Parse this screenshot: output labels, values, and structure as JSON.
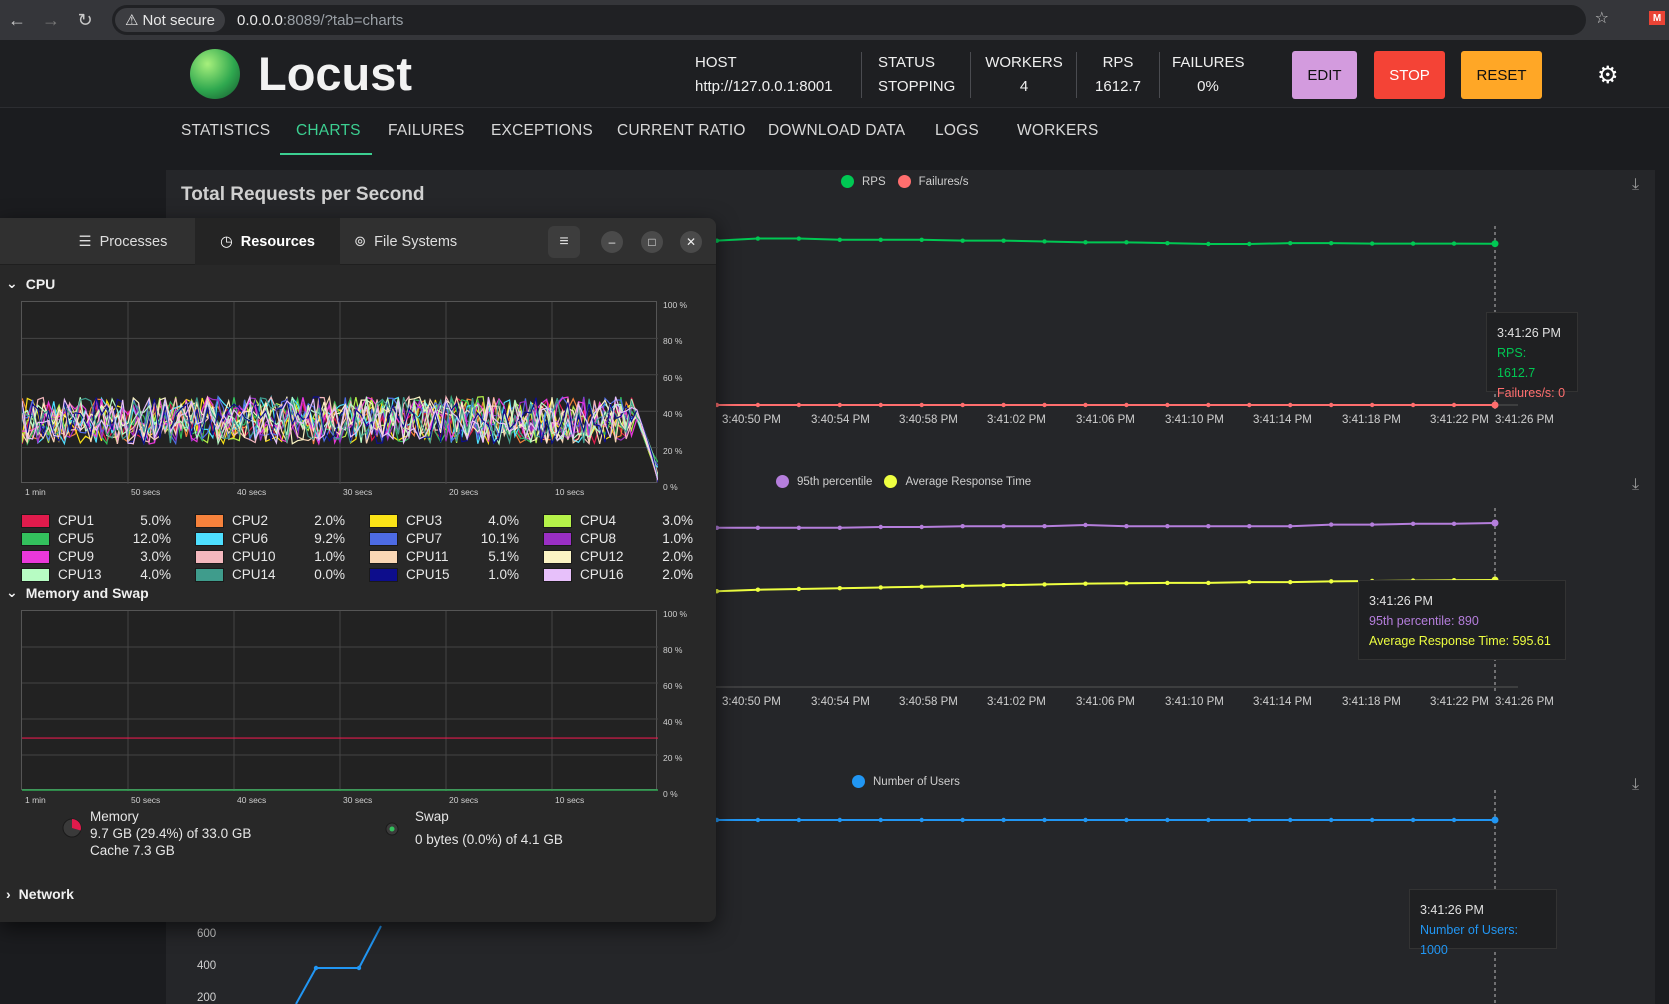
{
  "browser": {
    "not_secure": "Not secure",
    "url_host": "0.0.0.0",
    "url_rest": ":8089/?tab=charts"
  },
  "header": {
    "app_name": "Locust",
    "host_label": "HOST",
    "host_value": "http://127.0.0.1:8001",
    "status_label": "STATUS",
    "status_value": "STOPPING",
    "workers_label": "WORKERS",
    "workers_value": "4",
    "rps_label": "RPS",
    "rps_value": "1612.7",
    "failures_label": "FAILURES",
    "failures_value": "0%",
    "edit": "EDIT",
    "stop": "STOP",
    "reset": "RESET",
    "colors": {
      "edit": "#d39bde",
      "stop": "#f44336",
      "reset": "#ffa726"
    }
  },
  "tabs": [
    "STATISTICS",
    "CHARTS",
    "FAILURES",
    "EXCEPTIONS",
    "CURRENT RATIO",
    "DOWNLOAD DATA",
    "LOGS",
    "WORKERS"
  ],
  "active_tab": "CHARTS",
  "charts_panel": {
    "rps_chart_title": "Total Requests per Second",
    "x_ticks": [
      "M",
      "3:40:50 PM",
      "3:40:54 PM",
      "3:40:58 PM",
      "3:41:02 PM",
      "3:41:06 PM",
      "3:41:10 PM",
      "3:41:14 PM",
      "3:41:18 PM",
      "3:41:22 PM",
      "3:41:26 PM"
    ],
    "rps_legend": [
      "RPS",
      "Failures/s"
    ],
    "rps_tooltip": {
      "time": "3:41:26 PM",
      "rps": "RPS: 1612.7",
      "fail": "Failures/s: 0"
    },
    "rt_legend": [
      "95th percentile",
      "Average Response Time"
    ],
    "rt_tooltip": {
      "time": "3:41:26 PM",
      "p95": "95th percentile: 890",
      "avg": "Average Response Time: 595.61"
    },
    "users_legend": [
      "Number of Users"
    ],
    "users_tooltip": {
      "time": "3:41:26 PM",
      "users": "Number of Users: 1000"
    },
    "users_y_ticks": [
      "600",
      "400",
      "200"
    ],
    "colors": {
      "rps": "#00c853",
      "fail": "#ff6e6e",
      "p95": "#b57edc",
      "avg": "#eeff41",
      "users": "#2196f3"
    }
  },
  "chart_data": [
    {
      "type": "line",
      "series": [
        {
          "name": "RPS",
          "values": [
            1612,
            1620,
            1625,
            1625,
            1622,
            1622,
            1622,
            1620,
            1620,
            1618,
            1616,
            1616,
            1614,
            1612,
            1612,
            1614,
            1614,
            1613,
            1613,
            1613,
            1612.7
          ]
        },
        {
          "name": "Failures/s",
          "values": [
            0,
            0,
            0,
            0,
            0,
            0,
            0,
            0,
            0,
            0,
            0,
            0,
            0,
            0,
            0,
            0,
            0,
            0,
            0,
            0,
            0
          ]
        }
      ],
      "x_last": "3:41:26 PM"
    },
    {
      "type": "line",
      "series": [
        {
          "name": "95th percentile",
          "values": [
            880,
            878,
            878,
            878,
            878,
            880,
            880,
            882,
            882,
            882,
            885,
            882,
            882,
            882,
            882,
            882,
            886,
            886,
            888,
            888,
            890
          ]
        },
        {
          "name": "Average Response Time",
          "values": [
            560,
            566,
            570,
            572,
            574,
            576,
            578,
            580,
            582,
            584,
            586,
            587,
            588,
            588,
            590,
            590,
            592,
            593,
            594,
            595,
            595.61
          ]
        }
      ],
      "x_last": "3:41:26 PM"
    },
    {
      "type": "line",
      "series": [
        {
          "name": "Number of Users",
          "values": [
            1000,
            1000,
            1000,
            1000,
            1000,
            1000,
            1000,
            1000,
            1000,
            1000,
            1000,
            1000,
            1000,
            1000,
            1000,
            1000,
            1000,
            1000,
            1000,
            1000,
            1000
          ]
        }
      ],
      "y_ticks": [
        200,
        400,
        600
      ],
      "x_last": "3:41:26 PM"
    }
  ],
  "sysmon": {
    "tabs": [
      "Processes",
      "Resources",
      "File Systems"
    ],
    "active_tab": "Resources",
    "cpu_section": "CPU",
    "mem_section": "Memory and Swap",
    "net_section": "Network",
    "y_ticks": [
      "100 %",
      "80 %",
      "60 %",
      "40 %",
      "20 %",
      "0 %"
    ],
    "x_ticks": [
      "1 min",
      "50 secs",
      "40 secs",
      "30 secs",
      "20 secs",
      "10 secs"
    ],
    "cpus": [
      {
        "name": "CPU1",
        "pct": "5.0%",
        "color": "#e01b4c"
      },
      {
        "name": "CPU2",
        "pct": "2.0%",
        "color": "#f6823c"
      },
      {
        "name": "CPU3",
        "pct": "4.0%",
        "color": "#fae317"
      },
      {
        "name": "CPU4",
        "pct": "3.0%",
        "color": "#b5f249"
      },
      {
        "name": "CPU5",
        "pct": "12.0%",
        "color": "#33c15d"
      },
      {
        "name": "CPU6",
        "pct": "9.2%",
        "color": "#4edfff"
      },
      {
        "name": "CPU7",
        "pct": "10.1%",
        "color": "#4d6be4"
      },
      {
        "name": "CPU8",
        "pct": "1.0%",
        "color": "#9a2fc4"
      },
      {
        "name": "CPU9",
        "pct": "3.0%",
        "color": "#ea38da"
      },
      {
        "name": "CPU10",
        "pct": "1.0%",
        "color": "#f4b8be"
      },
      {
        "name": "CPU11",
        "pct": "5.1%",
        "color": "#fad7b5"
      },
      {
        "name": "CPU12",
        "pct": "2.0%",
        "color": "#fbf4c4"
      },
      {
        "name": "CPU13",
        "pct": "4.0%",
        "color": "#b7fcc3"
      },
      {
        "name": "CPU14",
        "pct": "0.0%",
        "color": "#3f9c8c"
      },
      {
        "name": "CPU15",
        "pct": "1.0%",
        "color": "#0d0d8c"
      },
      {
        "name": "CPU16",
        "pct": "2.0%",
        "color": "#e7c0fa"
      }
    ],
    "memory_label": "Memory",
    "memory_value": "9.7 GB (29.4%) of 33.0 GB",
    "cache_value": "Cache 7.3 GB",
    "memory_pct": 29.4,
    "swap_label": "Swap",
    "swap_value": "0 bytes (0.0%) of 4.1 GB",
    "swap_pct": 0
  }
}
